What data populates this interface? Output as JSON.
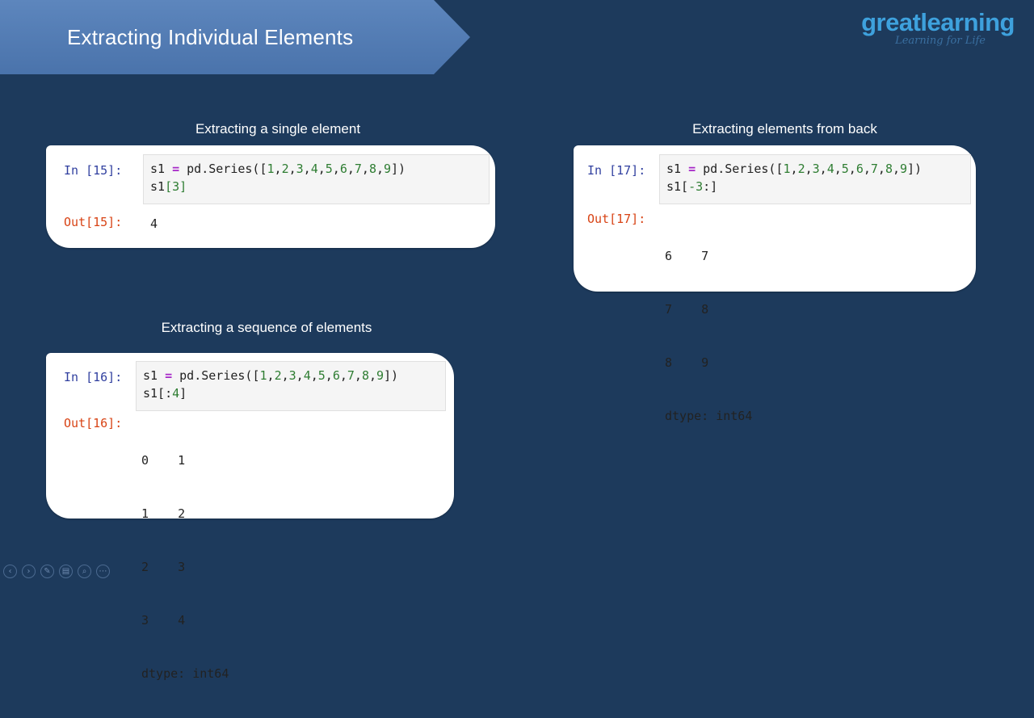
{
  "slide": {
    "title": "Extracting Individual Elements"
  },
  "logo": {
    "main_great": "great",
    "main_learning": "learning",
    "tagline": "Learning for Life"
  },
  "sections": {
    "single": {
      "label": "Extracting a single element",
      "in_prompt": "In [15]:",
      "out_prompt": "Out[15]:",
      "code_line1_parts": [
        "s1 ",
        "=",
        " pd.Series([",
        "1",
        ",",
        "2",
        ",",
        "3",
        ",",
        "4",
        ",",
        "5",
        ",",
        "6",
        ",",
        "7",
        ",",
        "8",
        ",",
        "9",
        "])"
      ],
      "code_line2": "s1[3]",
      "output": "4"
    },
    "back": {
      "label": "Extracting elements from back",
      "in_prompt": "In [17]:",
      "out_prompt": "Out[17]:",
      "code_line2": "s1[-3:]",
      "output_rows": [
        [
          "6",
          "7"
        ],
        [
          "7",
          "8"
        ],
        [
          "8",
          "9"
        ]
      ],
      "dtype": "dtype: int64"
    },
    "sequence": {
      "label": "Extracting a sequence of elements",
      "in_prompt": "In [16]:",
      "out_prompt": "Out[16]:",
      "code_line2": "s1[:4]",
      "output_rows": [
        [
          "0",
          "1"
        ],
        [
          "1",
          "2"
        ],
        [
          "2",
          "3"
        ],
        [
          "3",
          "4"
        ]
      ],
      "dtype": "dtype: int64"
    }
  },
  "controls": {
    "icons": [
      "prev-icon",
      "next-icon",
      "pen-icon",
      "slides-icon",
      "zoom-icon",
      "more-icon"
    ],
    "glyphs": [
      "‹",
      "›",
      "✎",
      "▤",
      "⌕",
      "⋯"
    ]
  },
  "colors": {
    "background": "#1d3a5c",
    "banner": "#5d86bd",
    "logo": "#3ea1dd",
    "in_prompt": "#303f9f",
    "out_prompt": "#d84315",
    "number": "#2e7d32",
    "operator": "#a626c7"
  }
}
